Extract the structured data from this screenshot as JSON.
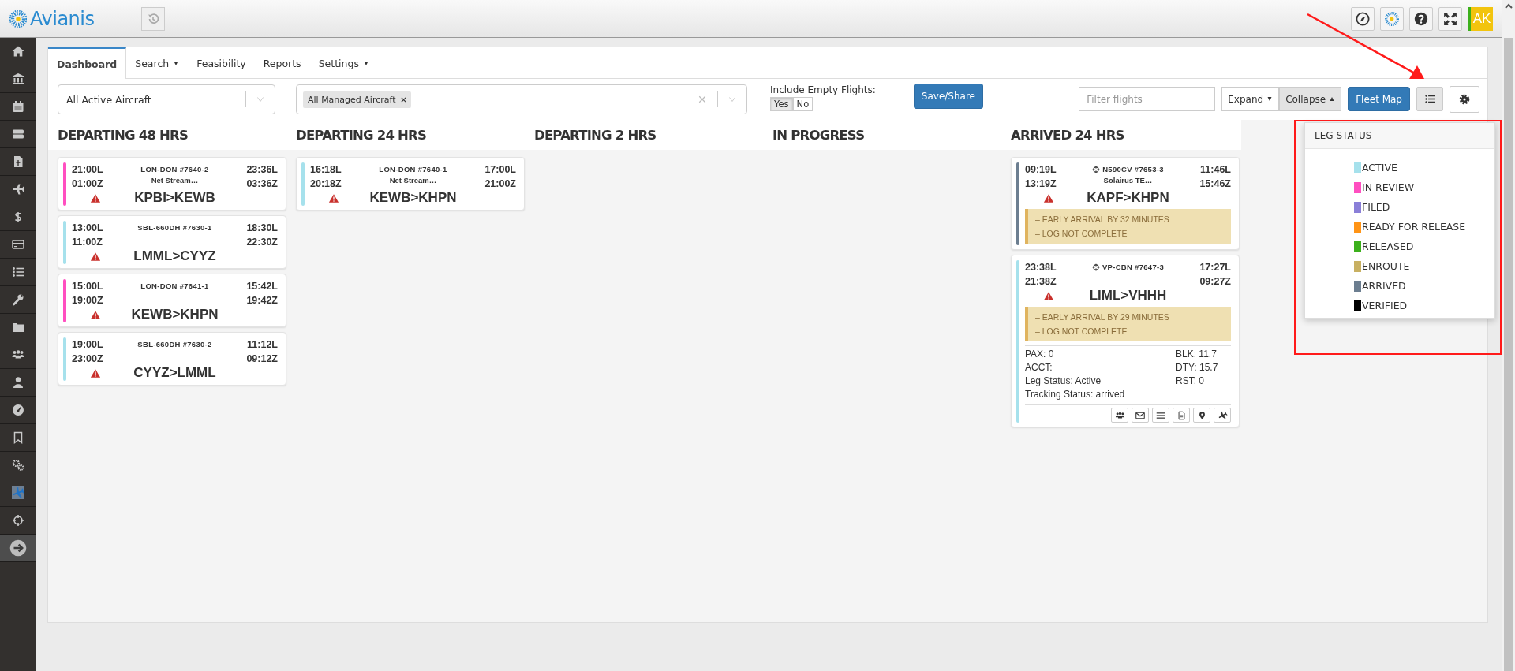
{
  "app": {
    "brand": "Avianis",
    "user_initials": "AK"
  },
  "tabs": [
    {
      "label": "Dashboard",
      "selected": true,
      "has_menu": false
    },
    {
      "label": "Search",
      "selected": false,
      "has_menu": true
    },
    {
      "label": "Feasibility",
      "selected": false,
      "has_menu": false
    },
    {
      "label": "Reports",
      "selected": false,
      "has_menu": false
    },
    {
      "label": "Settings",
      "selected": false,
      "has_menu": true
    }
  ],
  "filters": {
    "aircraft_select": {
      "value": "All Active Aircraft"
    },
    "managed_select": {
      "tags": [
        "All Managed Aircraft"
      ]
    },
    "include_empty": {
      "label": "Include Empty Flights:",
      "options": [
        {
          "label": "Yes",
          "selected": true
        },
        {
          "label": "No",
          "selected": false
        }
      ]
    },
    "save_button": "Save/Share",
    "filter_field": {
      "placeholder": "Filter flights"
    },
    "view_buttons": [
      {
        "label": "Expand",
        "selected": false,
        "kind": "down"
      },
      {
        "label": "Collapse",
        "selected": true,
        "kind": "up"
      }
    ],
    "fleet_map_button": "Fleet Map"
  },
  "columns": [
    {
      "title": "DEPARTING 48 HRS",
      "flights": [
        {
          "color": "#ff4fc0",
          "dep_local": "21:00L",
          "dep_zulu": "01:00Z",
          "arr_local": "23:36L",
          "arr_zulu": "03:36Z",
          "tracked": false,
          "aircraft": "LON-DON #7640-2",
          "customer": "Net Stream…",
          "warning": true,
          "route": "KPBI>KEWB",
          "expanded": false
        },
        {
          "color": "#a6e1ec",
          "dep_local": "13:00L",
          "dep_zulu": "11:00Z",
          "arr_local": "18:30L",
          "arr_zulu": "22:30Z",
          "tracked": false,
          "aircraft": "SBL-660DH #7630-1",
          "warning": true,
          "route": "LMML>CYYZ",
          "expanded": false
        },
        {
          "color": "#ff4fc0",
          "dep_local": "15:00L",
          "dep_zulu": "19:00Z",
          "arr_local": "15:42L",
          "arr_zulu": "19:42Z",
          "tracked": false,
          "aircraft": "LON-DON #7641-1",
          "warning": true,
          "route": "KEWB>KHPN",
          "expanded": false
        },
        {
          "color": "#a6e1ec",
          "dep_local": "19:00L",
          "dep_zulu": "23:00Z",
          "arr_local": "11:12L",
          "arr_zulu": "09:12Z",
          "tracked": false,
          "aircraft": "SBL-660DH #7630-2",
          "warning": true,
          "route": "CYYZ>LMML",
          "expanded": false
        }
      ]
    },
    {
      "title": "DEPARTING 24 HRS",
      "flights": [
        {
          "color": "#a6e1ec",
          "dep_local": "16:18L",
          "dep_zulu": "20:18Z",
          "arr_local": "17:00L",
          "arr_zulu": "21:00Z",
          "tracked": false,
          "aircraft": "LON-DON #7640-1",
          "customer": "Net Stream…",
          "warning": true,
          "route": "KEWB>KHPN",
          "expanded": false
        }
      ]
    },
    {
      "title": "DEPARTING 2 HRS"
    },
    {
      "title": "IN PROGRESS"
    },
    {
      "title": "ARRIVED 24 HRS",
      "flights": [
        {
          "color": "#6c7e90",
          "dep_local": "09:19L",
          "dep_zulu": "13:19Z",
          "arr_local": "11:46L",
          "arr_zulu": "15:46Z",
          "tracked": true,
          "aircraft": "N590CV #7653-3",
          "customer": "Solairus TE…",
          "warning": true,
          "route": "KAPF>KHPN",
          "alerts": [
            "– EARLY ARRIVAL BY 32 MINUTES",
            "– LOG NOT COMPLETE"
          ],
          "expanded": false
        },
        {
          "color": "#a6e1ec",
          "dep_local": "23:38L",
          "dep_zulu": "21:38Z",
          "arr_local": "17:27L",
          "arr_zulu": "09:27Z",
          "tracked": true,
          "aircraft": "VP-CBN #7647-3",
          "warning": true,
          "route": "LIML>VHHH",
          "alerts": [
            "– EARLY ARRIVAL BY 29 MINUTES",
            "– LOG NOT COMPLETE"
          ],
          "expanded": true,
          "details_left": [
            "PAX: 0",
            "ACCT:",
            "Leg Status: Active",
            "Tracking Status: arrived"
          ],
          "details_right": [
            "BLK: 11.7",
            "DTY: 15.7",
            "RST: 0"
          ]
        }
      ]
    }
  ],
  "legend": {
    "open": true,
    "title": "LEG STATUS",
    "items": [
      {
        "label": "ACTIVE",
        "color": "#a6e1ec"
      },
      {
        "label": "IN REVIEW",
        "color": "#ff4fc0"
      },
      {
        "label": "FILED",
        "color": "#8a7fd8"
      },
      {
        "label": "READY FOR RELEASE",
        "color": "#ff9416"
      },
      {
        "label": "RELEASED",
        "color": "#3cb01c"
      },
      {
        "label": "ENROUTE",
        "color": "#c8b062"
      },
      {
        "label": "ARRIVED",
        "color": "#6c7e90"
      },
      {
        "label": "VERIFIED",
        "color": "#000000"
      }
    ]
  }
}
